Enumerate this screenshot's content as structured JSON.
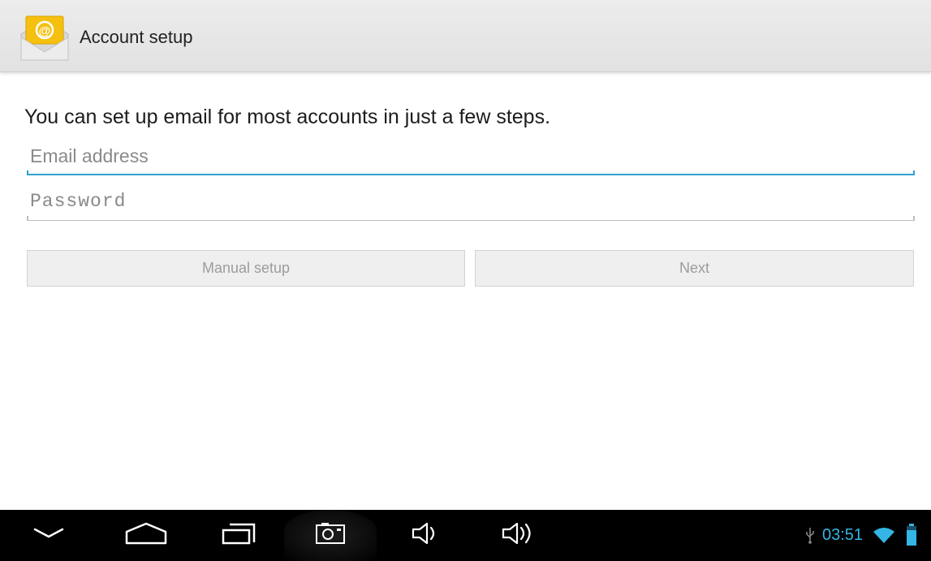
{
  "action_bar": {
    "title": "Account setup",
    "icon": "email-app-icon"
  },
  "content": {
    "intro": "You can set up email for most accounts in just a few steps.",
    "email_field": {
      "placeholder": "Email address",
      "value": ""
    },
    "password_field": {
      "placeholder": "Password",
      "value": ""
    },
    "buttons": {
      "manual_setup": "Manual setup",
      "next": "Next"
    }
  },
  "nav_bar": {
    "icons": [
      "back-icon",
      "home-icon",
      "recent-apps-icon",
      "screenshot-icon",
      "volume-down-icon",
      "volume-up-icon"
    ]
  },
  "status": {
    "time": "03:51",
    "icons": [
      "usb-icon",
      "wifi-icon",
      "battery-icon"
    ]
  },
  "colors": {
    "accent": "#34b5e5",
    "focus_line": "#2f9fcf",
    "action_bar_bg": "#e6e6e6",
    "nav_bar_bg": "#000000"
  }
}
